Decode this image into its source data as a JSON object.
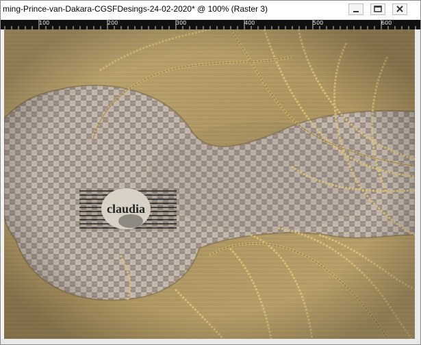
{
  "window": {
    "title": "ming-Prince-van-Dakara-CGSFDesings-24-02-2020* @ 100% (Raster 3)",
    "controls": {
      "minimize": "minimize-icon",
      "maximize": "maximize-icon",
      "close": "close-icon"
    }
  },
  "ruler": {
    "labels": [
      "100",
      "200",
      "300",
      "400",
      "500",
      "600"
    ]
  },
  "canvas": {
    "watermark_text": "claudia",
    "colors": {
      "gold": "#b49a62",
      "gold_dark": "#7e6838",
      "check_light": "#c6bcb0",
      "check_dark": "#9c8f86"
    }
  }
}
